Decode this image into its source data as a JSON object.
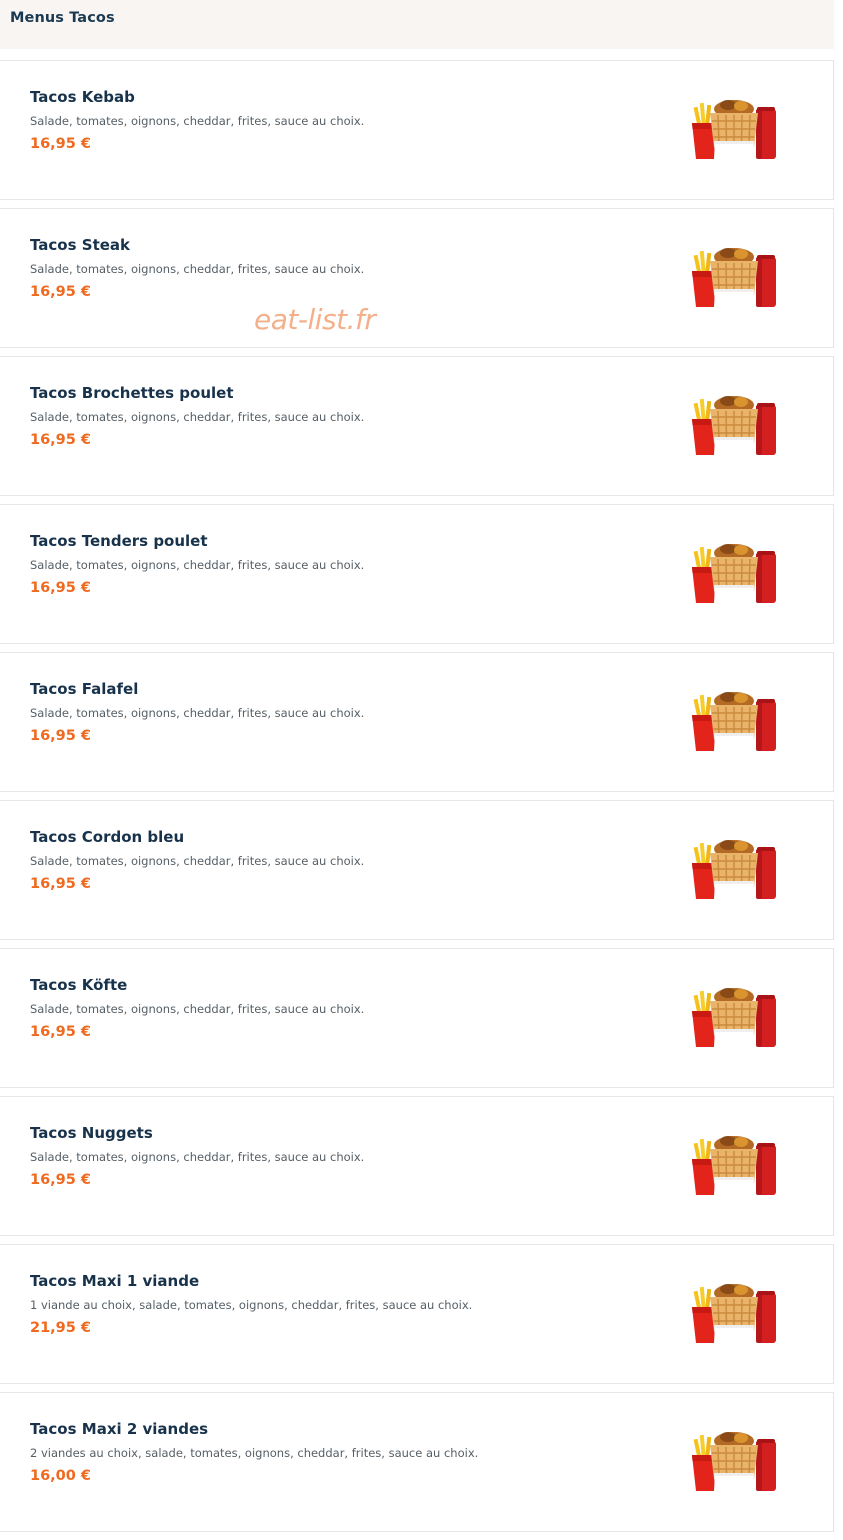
{
  "section": {
    "title": "Menus Tacos"
  },
  "watermark": "eat-list.fr",
  "colors": {
    "header_bg": "#f8f5f2",
    "title_text": "#17324a",
    "price": "#ef6a1f",
    "description": "#555f66",
    "card_border": "#e6e6e6"
  },
  "items": [
    {
      "name": "Tacos Kebab",
      "description": "Salade, tomates, oignons, cheddar, frites, sauce au choix.",
      "price": "16,95 €",
      "image": "tacos-menu-image"
    },
    {
      "name": "Tacos Steak",
      "description": "Salade, tomates, oignons, cheddar, frites, sauce au choix.",
      "price": "16,95 €",
      "image": "tacos-menu-image"
    },
    {
      "name": "Tacos Brochettes poulet",
      "description": "Salade, tomates, oignons, cheddar, frites, sauce au choix.",
      "price": "16,95 €",
      "image": "tacos-menu-image"
    },
    {
      "name": "Tacos Tenders poulet",
      "description": "Salade, tomates, oignons, cheddar, frites, sauce au choix.",
      "price": "16,95 €",
      "image": "tacos-menu-image"
    },
    {
      "name": "Tacos Falafel",
      "description": "Salade, tomates, oignons, cheddar, frites, sauce au choix.",
      "price": "16,95 €",
      "image": "tacos-menu-image"
    },
    {
      "name": "Tacos Cordon bleu",
      "description": "Salade, tomates, oignons, cheddar, frites, sauce au choix.",
      "price": "16,95 €",
      "image": "tacos-menu-image"
    },
    {
      "name": "Tacos Köfte",
      "description": "Salade, tomates, oignons, cheddar, frites, sauce au choix.",
      "price": "16,95 €",
      "image": "tacos-menu-image"
    },
    {
      "name": "Tacos Nuggets",
      "description": "Salade, tomates, oignons, cheddar, frites, sauce au choix.",
      "price": "16,95 €",
      "image": "tacos-menu-image"
    },
    {
      "name": "Tacos Maxi 1 viande",
      "description": "1 viande au choix, salade, tomates, oignons, cheddar, frites, sauce au choix.",
      "price": "21,95 €",
      "image": "tacos-menu-image"
    },
    {
      "name": "Tacos Maxi 2 viandes",
      "description": "2 viandes au choix, salade, tomates, oignons, cheddar, frites, sauce au choix.",
      "price": "16,00 €",
      "image": "tacos-menu-image"
    }
  ]
}
